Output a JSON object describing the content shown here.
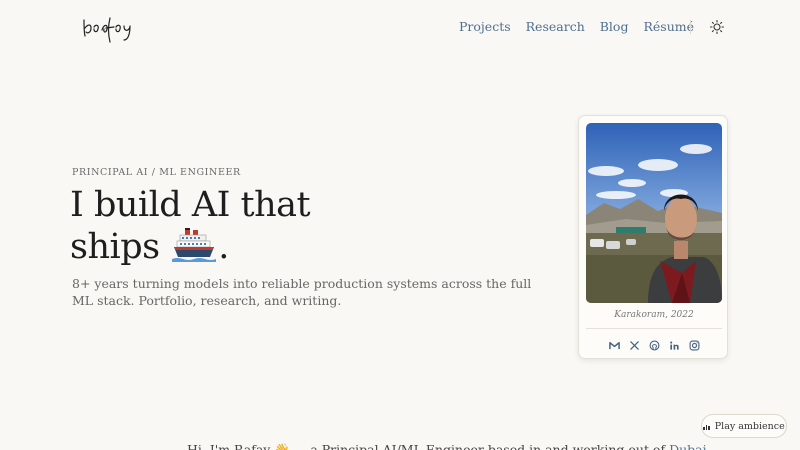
{
  "nav": {
    "items": [
      "Projects",
      "Research",
      "Blog",
      "Résumé"
    ]
  },
  "hero": {
    "eyebrow": "PRINCIPAL AI / ML ENGINEER",
    "headline_line1": "I build AI that",
    "headline_line2_pre": "ships",
    "headline_line2_post": ".",
    "subtitle": "8+ years turning models into reliable production systems across the full ML stack. Portfolio, research, and writing."
  },
  "profile_card": {
    "caption": "Karakoram, 2022",
    "socials": [
      "gmail-icon",
      "x-icon",
      "github-icon",
      "linkedin-icon",
      "instagram-icon"
    ]
  },
  "ambience": {
    "label": "Play ambience"
  },
  "intro": {
    "text_pre": "Hi, I'm Rafay 👋 — a Principal AI/ML Engineer based in and working out of",
    "link": "Dubai"
  },
  "colors": {
    "background": "#f9f8f4",
    "accent": "#4f6f8f",
    "text": "#1e1e1e"
  }
}
